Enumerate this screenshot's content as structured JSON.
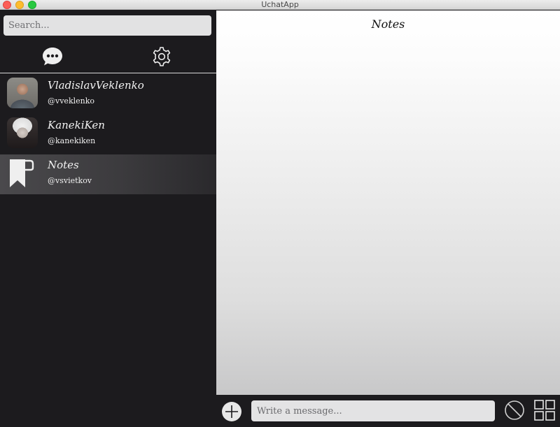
{
  "window": {
    "title": "UchatApp"
  },
  "search": {
    "placeholder": "Search..."
  },
  "tabs": [
    {
      "icon": "chat-bubble-icon"
    },
    {
      "icon": "gear-icon"
    }
  ],
  "contacts": [
    {
      "name": "VladislavVeklenko",
      "handle": "@vveklenko",
      "avatar": "avatar-photo"
    },
    {
      "name": "KanekiKen",
      "handle": "@kanekiken",
      "avatar": "avatar-photo"
    },
    {
      "name": "Notes",
      "handle": "@vsvietkov",
      "avatar": "bookmark-icon",
      "active": true
    }
  ],
  "chat": {
    "title": "Notes"
  },
  "composer": {
    "placeholder": "Write a message..."
  },
  "colors": {
    "sidebar_bg": "#1c1b1e",
    "accent_text": "#f2f2f2",
    "input_bg": "#e2e2e3"
  }
}
